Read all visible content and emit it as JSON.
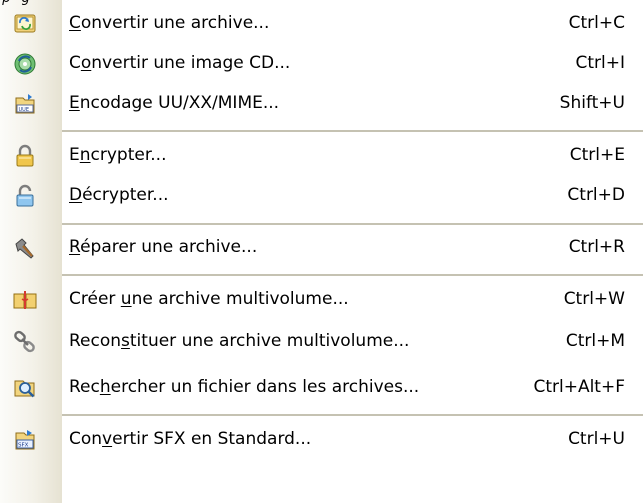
{
  "menu": {
    "items": [
      {
        "pre": "",
        "key": "C",
        "post": "onvertir une archive...",
        "shortcut": "Ctrl+C",
        "icon": "convert-archive-icon"
      },
      {
        "pre": "C",
        "key": "o",
        "post": "nvertir une image CD...",
        "shortcut": "Ctrl+I",
        "icon": "convert-cd-image-icon"
      },
      {
        "pre": "",
        "key": "E",
        "post": "ncodage UU/XX/MIME...",
        "shortcut": "Shift+U",
        "icon": "encoding-uue-icon"
      },
      {
        "pre": "E",
        "key": "n",
        "post": "crypter...",
        "shortcut": "Ctrl+E",
        "icon": "lock-closed-icon"
      },
      {
        "pre": "",
        "key": "D",
        "post": "écrypter...",
        "shortcut": "Ctrl+D",
        "icon": "lock-open-icon"
      },
      {
        "pre": "",
        "key": "R",
        "post": "éparer une archive...",
        "shortcut": "Ctrl+R",
        "icon": "hammer-repair-icon"
      },
      {
        "pre": "Créer ",
        "key": "u",
        "post": "ne archive multivolume...",
        "shortcut": "Ctrl+W",
        "icon": "split-archive-icon"
      },
      {
        "pre": "Recon",
        "key": "s",
        "post": "tituer une archive multivolume...",
        "shortcut": "Ctrl+M",
        "icon": "chain-link-icon"
      },
      {
        "pre": "Rec",
        "key": "h",
        "post": "ercher un fichier dans les archives...",
        "shortcut": "Ctrl+Alt+F",
        "icon": "search-archive-icon"
      },
      {
        "pre": "Con",
        "key": "v",
        "post": "ertir SFX en Standard...",
        "shortcut": "Ctrl+U",
        "icon": "sfx-convert-icon"
      }
    ]
  }
}
